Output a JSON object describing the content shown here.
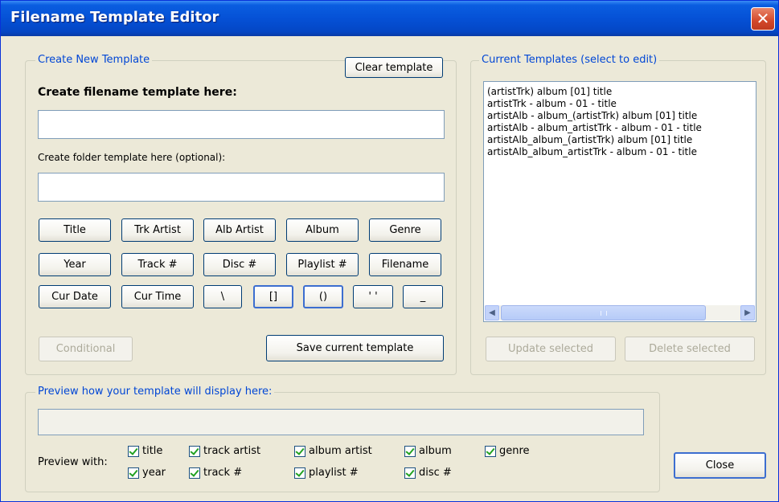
{
  "window": {
    "title": "Filename Template Editor",
    "close_glyph": "✕",
    "close_label": "Close"
  },
  "create": {
    "legend": "Create New Template",
    "clear_button": "Clear template",
    "filename_label": "Create filename template here:",
    "filename_value": "",
    "folder_label": "Create folder template here (optional):",
    "folder_value": "",
    "token_buttons": [
      [
        "Title",
        "Trk Artist",
        "Alb Artist",
        "Album",
        "Genre"
      ],
      [
        "Year",
        "Track #",
        "Disc #",
        "Playlist #",
        "Filename"
      ],
      [
        "Cur Date",
        "Cur Time",
        "\\",
        "[]",
        "()",
        "' '",
        "_"
      ]
    ],
    "conditional_button": "Conditional",
    "save_button": "Save current template"
  },
  "current": {
    "legend": "Current Templates (select to edit)",
    "items": [
      "(artistTrk) album [01] title",
      "artistTrk - album - 01 - title",
      "artistAlb - album_(artistTrk) album [01] title",
      "artistAlb - album_artistTrk - album - 01 - title",
      "artistAlb_album_(artistTrk) album [01] title",
      "artistAlb_album_artistTrk - album - 01 - title"
    ],
    "update_button": "Update selected",
    "delete_button": "Delete selected"
  },
  "preview": {
    "legend": "Preview how your template will display here:",
    "value": "",
    "with_label": "Preview with:",
    "checkboxes": {
      "title": "title",
      "track_artist": "track artist",
      "album_artist": "album artist",
      "album": "album",
      "genre": "genre",
      "year": "year",
      "track_num": "track #",
      "playlist_num": "playlist #",
      "disc_num": "disc #"
    }
  },
  "icons": {
    "close": "close-icon",
    "scroll_left": "chevron-left-icon",
    "scroll_right": "chevron-right-icon"
  },
  "colors": {
    "title_bar": "#0551d6",
    "accent": "#0046d5",
    "window_bg": "#ece9d8"
  }
}
